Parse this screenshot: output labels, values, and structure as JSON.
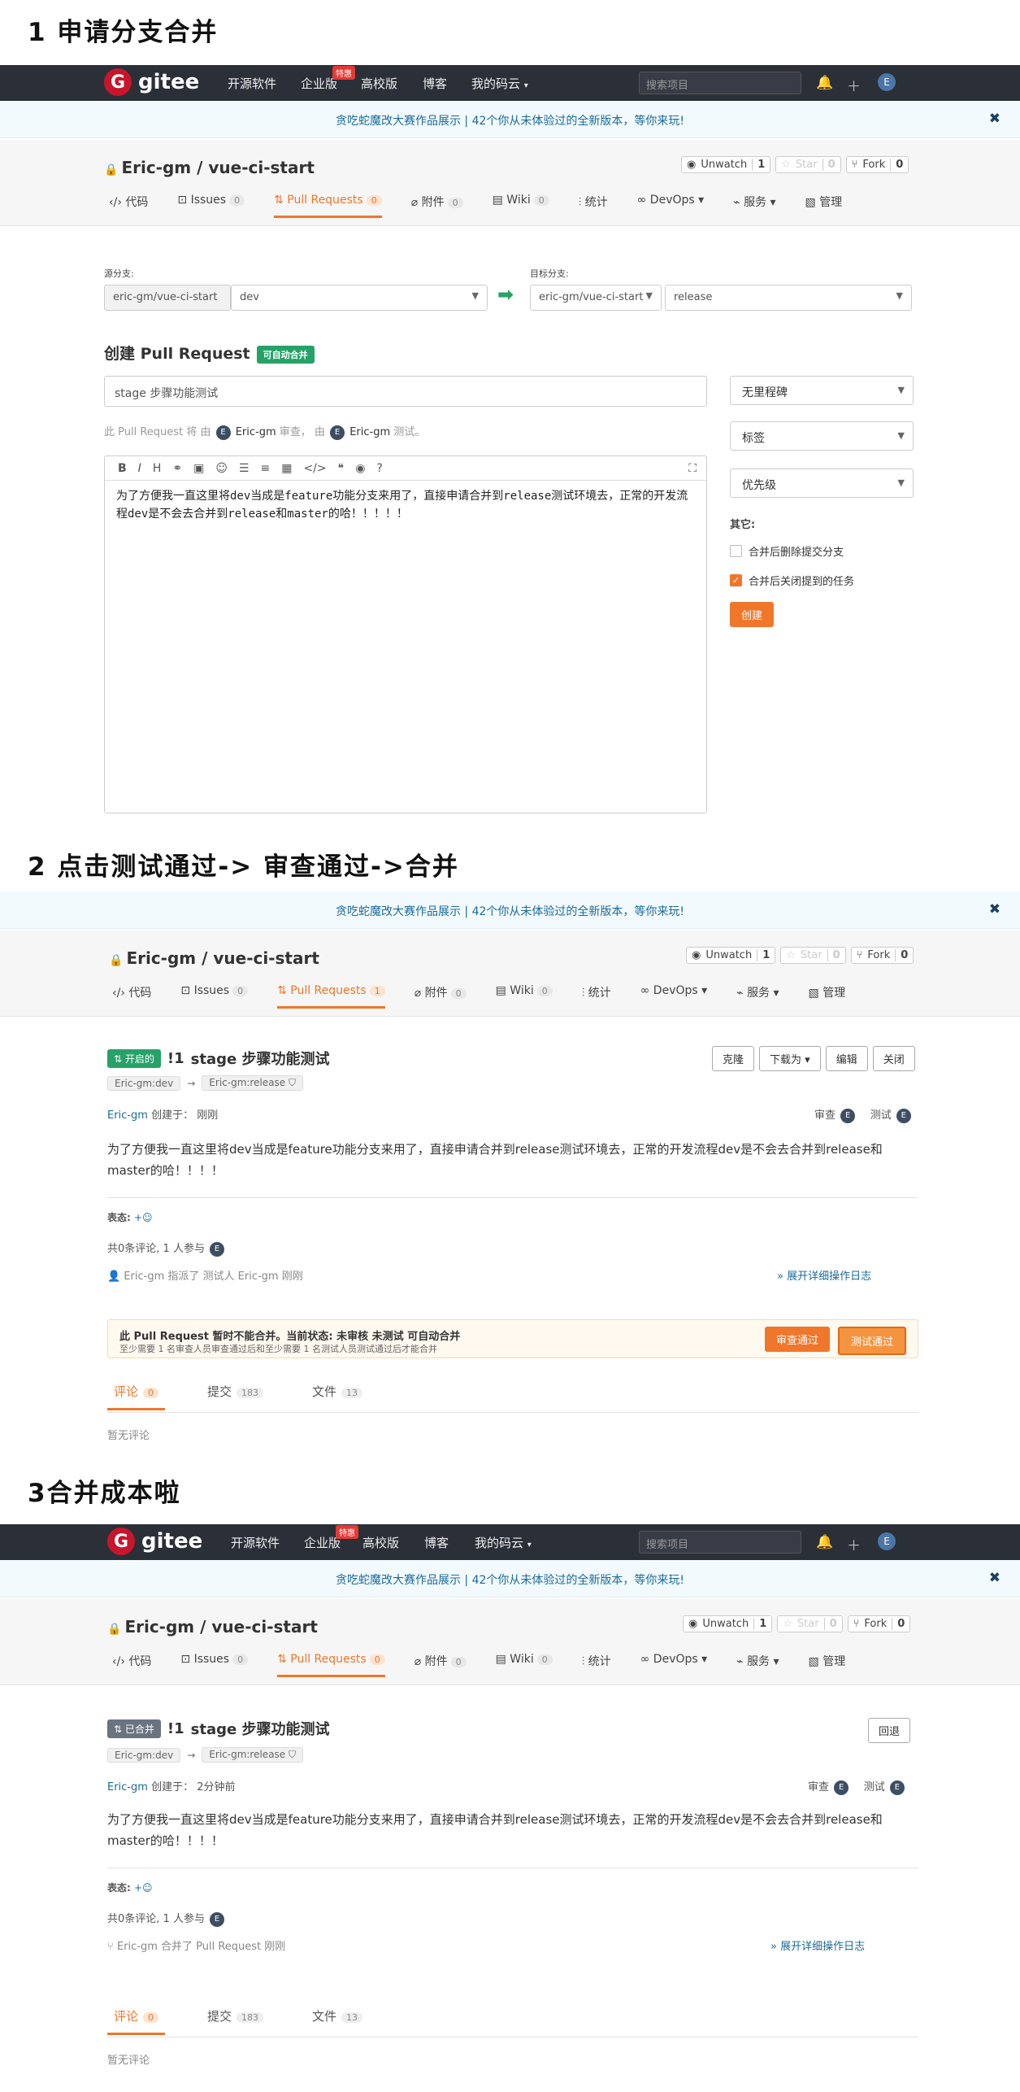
{
  "sections": {
    "s1": "1 申请分支合并",
    "s2": "2 点击测试通过-> 审查通过->合并",
    "s3": "3合并成本啦"
  },
  "nav": {
    "logo": "gitee",
    "items": [
      "开源软件",
      "企业版",
      "高校版",
      "博客",
      "我的码云"
    ],
    "hot": "特惠",
    "search_placeholder": "搜索项目",
    "avatar": "E"
  },
  "banner": {
    "text": "贪吃蛇魔改大赛作品展示 | 42个你从未体验过的全新版本，等你来玩!",
    "close": "✖"
  },
  "project": {
    "title": "Eric-gm / vue-ci-start",
    "watch": "Unwatch",
    "watch_count": "1",
    "star": "Star",
    "star_count": "0",
    "fork": "Fork",
    "fork_count": "0",
    "tabs": [
      "代码",
      "Issues",
      "Pull Requests",
      "附件",
      "Wiki",
      "统计",
      "DevOps",
      "服务",
      "管理"
    ],
    "tab_counts": {
      "issues": "0",
      "pr": "0",
      "pr_open": "1",
      "attach": "0",
      "wiki": "0"
    }
  },
  "create": {
    "src_label": "源分支:",
    "src_repo": "eric-gm/vue-ci-start",
    "src_branch": "dev",
    "dst_label": "目标分支:",
    "dst_repo": "eric-gm/vue-ci-start",
    "dst_branch": "release",
    "heading": "创建 Pull Request",
    "auto_merge": "可自动合并",
    "title_value": "stage 步骤功能测试",
    "hint_pre": "此 Pull Request 将 由",
    "hint_user": "Eric-gm",
    "hint_review": "审查， 由",
    "hint_test": "测试。",
    "toolbar": [
      "B",
      "I",
      "H",
      "⚭",
      "▣",
      "☺",
      "☰",
      "≡",
      "▦",
      "</>",
      "❝",
      "◉",
      "?"
    ],
    "body_line1": "为了方便我一直这里将dev当成是feature功能分支来用了，直接申请合并到release测试环境去，正常的开发流",
    "body_line2": "程dev是不会去合并到release和master的哈！！！！！",
    "milestone": "无里程碑",
    "labels": "标签",
    "priority": "优先级",
    "other": "其它:",
    "opt_delete": "合并后删除提交分支",
    "opt_close": "合并后关闭提到的任务",
    "submit": "创建"
  },
  "pr_open": {
    "status": "开启的",
    "number": "!1",
    "title": "stage 步骤功能测试",
    "from": "Eric-gm:dev",
    "to": "Eric-gm:release",
    "author": "Eric-gm",
    "created_label": "创建于：",
    "created": "刚刚",
    "review_label": "审查",
    "test_label": "测试",
    "buttons": [
      "克隆",
      "下载为",
      "编辑",
      "关闭"
    ],
    "desc": "为了方便我一直这里将dev当成是feature功能分支来用了，直接申请合并到release测试环境去，正常的开发流程dev是不会去合并到release和master的哈！！！！",
    "reaction_label": "表态:",
    "comments_summary": "共0条评论, 1 人参与",
    "activity": "Eric-gm 指派了 测试人 Eric-gm  刚刚",
    "expand": "展开详细操作日志",
    "warn_title": "此 Pull Request 暂时不能合并。当前状态: 未审核 未测试 可自动合并",
    "warn_sub": "至少需要 1 名审查人员审查通过后和至少需要 1 名测试人员测试通过后才能合并",
    "review_btn": "审查通过",
    "test_btn": "测试通过",
    "ctabs": [
      "评论",
      "提交",
      "文件"
    ],
    "ccounts": [
      "0",
      "183",
      "13"
    ],
    "no_comment": "暂无评论"
  },
  "pr_merged": {
    "status": "已合并",
    "created": "2分钟前",
    "rollback": "回退",
    "activity": "Eric-gm 合并了 Pull Request  刚刚"
  }
}
